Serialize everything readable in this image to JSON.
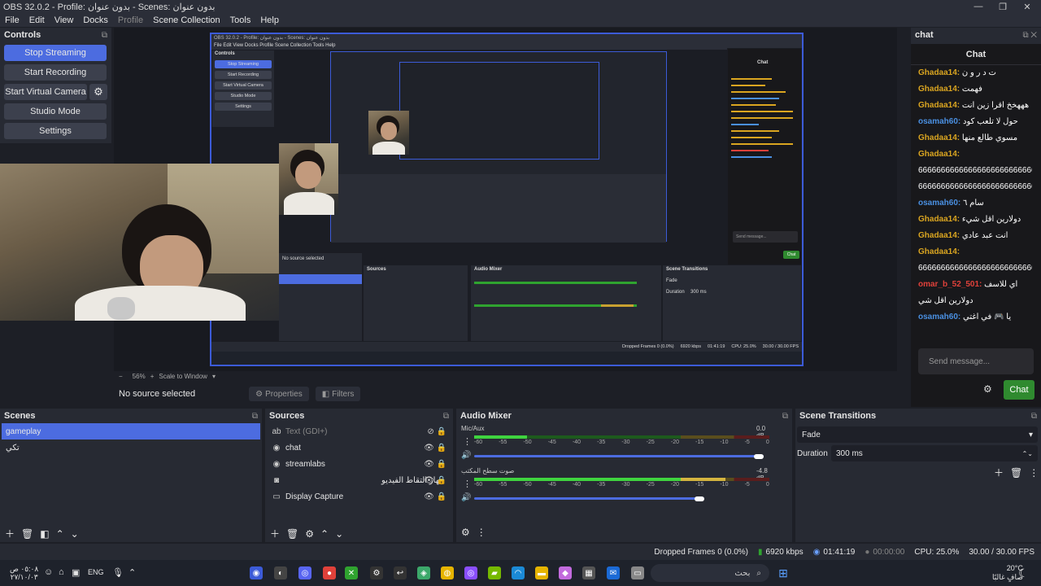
{
  "window": {
    "title": "OBS 32.0.2 - Profile: بدون عنوان - Scenes: بدون عنوان",
    "controls": [
      "—",
      "❐",
      "✕"
    ]
  },
  "menu": [
    "File",
    "Edit",
    "View",
    "Docks",
    "Profile",
    "Scene Collection",
    "Tools",
    "Help"
  ],
  "controls": {
    "title": "Controls",
    "buttons": [
      "Stop Streaming",
      "Start Recording",
      "Start Virtual Camera",
      "Studio Mode",
      "Settings"
    ]
  },
  "preview": {
    "nested_title": "OBS 32.0.2 - Profile: بدون عنوان - Scenes: بدون عنوان",
    "nested_menu": "File  Edit  View  Docks  Profile  Scene Collection  Tools  Help",
    "nested_controls_title": "Controls",
    "nested_buttons": [
      "Stop Streaming",
      "Start Recording",
      "Start Virtual Camera",
      "Studio Mode",
      "Settings"
    ],
    "nested_chat_title": "Chat",
    "nested_send": "Send message...",
    "nested_chat_btn": "Chat",
    "nested_no_source": "No source selected",
    "nested_sources": "Sources",
    "nested_audio": "Audio Mixer",
    "nested_transitions": "Scene Transitions",
    "nested_fade": "Fade",
    "nested_duration": "Duration",
    "nested_duration_value": "300 ms",
    "nested_dropped": "Dropped Frames 0 (0.0%)",
    "nested_kbps": "6920 kbps",
    "nested_time": "01:41:19",
    "nested_cpu": "CPU: 25.0%",
    "nested_fps": "30.00 / 30.00 FPS"
  },
  "zoom": {
    "value": "56%",
    "plus": "+",
    "minus": "−",
    "mode": "Scale to Window"
  },
  "selection": {
    "no_source": "No source selected",
    "properties": "Properties",
    "filters": "Filters"
  },
  "chat": {
    "dock_title": "chat",
    "header": "Chat",
    "messages": [
      {
        "user": "Ghadaa14",
        "text": "ت د ر و ن",
        "color": "#daa520"
      },
      {
        "user": "Ghadaa14",
        "text": "فهمت",
        "color": "#daa520"
      },
      {
        "user": "Ghadaa14",
        "text": "هههخخ اقرا زين انت",
        "color": "#daa520"
      },
      {
        "user": "osamah60",
        "text": "حول لا تلعب كود",
        "color": "#4a90e2"
      },
      {
        "user": "Ghadaa14",
        "text": "مسوي طالع منها",
        "color": "#daa520"
      },
      {
        "user": "Ghadaa14",
        "text": "",
        "color": "#daa520"
      },
      {
        "user": "",
        "text": "66666666666666666666666666666666",
        "color": "#daa520"
      },
      {
        "user": "",
        "text": "66666666666666666666666666666666",
        "color": "#daa520"
      },
      {
        "user": "osamah60",
        "text": "سام ٦",
        "color": "#4a90e2"
      },
      {
        "user": "Ghadaa14",
        "text": "دولارين اقل شيء",
        "color": "#daa520"
      },
      {
        "user": "Ghadaa14",
        "text": "انت عبد عادي",
        "color": "#daa520"
      },
      {
        "user": "Ghadaa14",
        "text": "",
        "color": "#daa520"
      },
      {
        "user": "",
        "text": "66666666666666666666666666666666",
        "color": "#daa520"
      },
      {
        "user": "omar_b_52_501",
        "text": "اي للاسف",
        "color": "#e0413a"
      },
      {
        "user": "",
        "text": "دولارين اقل شي",
        "color": "#e0413a"
      },
      {
        "user": "osamah60",
        "text": "يا 🎮 في اغتي",
        "color": "#4a90e2"
      }
    ],
    "send_placeholder": "Send message...",
    "chat_button": "Chat"
  },
  "scenes": {
    "title": "Scenes",
    "items": [
      "gameplay",
      "تكي"
    ]
  },
  "sources": {
    "title": "Sources",
    "items": [
      {
        "name": "Text (GDI+)",
        "icon": "ab",
        "dim": true
      },
      {
        "name": "chat",
        "icon": "◉",
        "dim": false
      },
      {
        "name": "streamlabs",
        "icon": "◉",
        "dim": false
      },
      {
        "name": "جهاز التقاط الفيديو",
        "icon": "◙",
        "dim": false
      },
      {
        "name": "Display Capture",
        "icon": "▭",
        "dim": false
      }
    ]
  },
  "audio": {
    "title": "Audio Mixer",
    "channels": [
      {
        "name": "Mic/Aux",
        "db": "0.0 dB",
        "level": 0.18,
        "volume": 0.98
      },
      {
        "name": "صوت سطح المكتب",
        "db": "-4.8 dB",
        "level": 0.85,
        "volume": 0.78
      }
    ],
    "scale": [
      "-60",
      "-55",
      "-50",
      "-45",
      "-40",
      "-35",
      "-30",
      "-25",
      "-20",
      "-15",
      "-10",
      "-5",
      "0"
    ]
  },
  "transitions": {
    "title": "Scene Transitions",
    "type": "Fade",
    "duration_label": "Duration",
    "duration": "300 ms"
  },
  "status": {
    "dropped": "Dropped Frames 0 (0.0%)",
    "kbps": "6920 kbps",
    "stream_time": "01:41:19",
    "rec_time": "00:00:00",
    "cpu": "CPU: 25.0%",
    "fps": "30.00 / 30.00 FPS"
  },
  "taskbar": {
    "clock": "٠٥:٠٨ ص",
    "date": "٢٧/١٠/٠٣",
    "lang": "ENG",
    "search": "بحث",
    "weather_temp": "20°C",
    "weather_desc": "صافٍ غالبًا"
  }
}
